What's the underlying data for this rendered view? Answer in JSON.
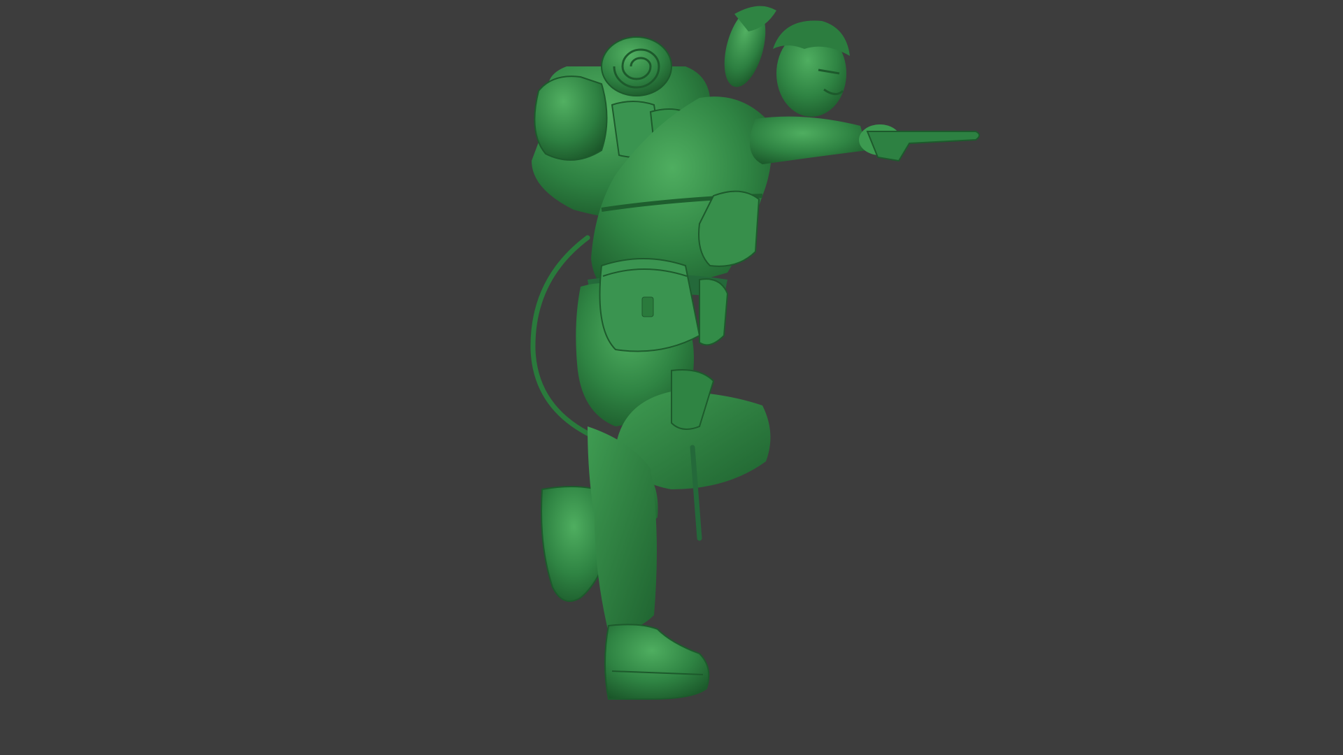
{
  "scene": {
    "background_color": "#3d3d3d",
    "model_color": "#2e7d3f",
    "model_highlight": "#4caa5c",
    "model_shadow": "#1d5a2c",
    "subject": "green-plastic-army-soldier-sculpt"
  }
}
